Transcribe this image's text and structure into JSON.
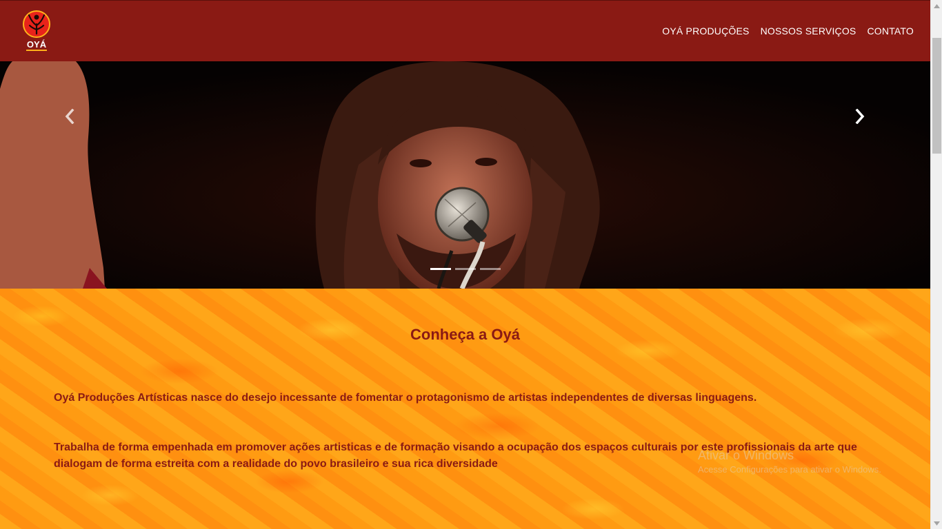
{
  "navbar": {
    "logo_text": "OYÁ",
    "links": [
      "OYÁ PRODUÇÕES",
      "NOSSOS SERVIÇOS",
      "CONTATO"
    ]
  },
  "carousel": {
    "slide_count": 3,
    "active_index": 0
  },
  "about": {
    "title": "Conheça a Oyá",
    "paragraph_1": "Oyá Produções Artísticas nasce do desejo incessante de fomentar o protagonismo de artistas independentes de diversas linguagens.",
    "paragraph_2": "Trabalha de forma empenhada em promover ações artisticas e de formação visando a ocupação dos espaços culturais por este profissionais da arte que dialogam de forma estreita com a realidade do povo brasileiro e sua rica diversidade"
  },
  "watermark": {
    "line_1": "Ativar o Windows",
    "line_2": "Acesse Configurações para ativar o Windows."
  },
  "colors": {
    "brand": "#8a1a14",
    "section_bg": "#ff9a14"
  },
  "icons": [
    "oya-logo-icon",
    "chevron-left-icon",
    "chevron-right-icon"
  ]
}
